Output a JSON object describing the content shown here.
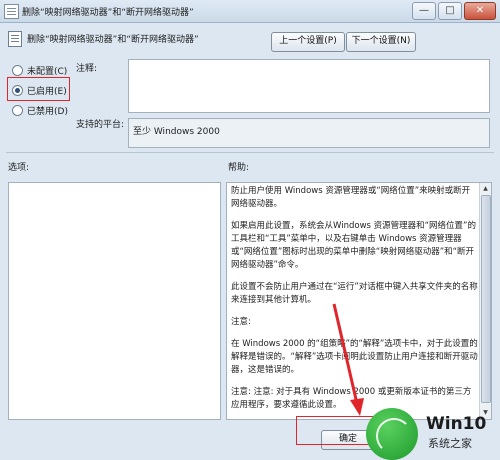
{
  "window": {
    "title": "删除“映射网络驱动器”和“断开网络驱动器”",
    "minimize": "—",
    "maximize": "□",
    "close": "✕"
  },
  "header": {
    "title": "删除“映射网络驱动器”和“断开网络驱动器”",
    "prev_button": "上一个设置(P)",
    "next_button": "下一个设置(N)"
  },
  "state": {
    "options": [
      {
        "label": "未配置(C)",
        "selected": false
      },
      {
        "label": "已启用(E)",
        "selected": true
      },
      {
        "label": "已禁用(D)",
        "selected": false
      }
    ]
  },
  "comment": {
    "label": "注释:",
    "value": ""
  },
  "platform": {
    "label": "支持的平台:",
    "value": "至少 Windows 2000"
  },
  "panels": {
    "options_label": "选项:",
    "help_label": "帮助:"
  },
  "help": {
    "paragraphs": [
      "防止用户使用 Windows 资源管理器或“网络位置”来映射或断开网络驱动器。",
      "如果启用此设置，系统会从Windows 资源管理器和“网络位置”的工具栏和“工具”菜单中，以及右键单击 Windows 资源管理器或“网络位置”图标时出现的菜单中删除“映射网络驱动器”和“断开网络驱动器”命令。",
      "此设置不会防止用户通过在“运行”对话框中键入共享文件夹的名称来连接到其他计算机。",
      "注意:",
      "在 Windows 2000 的“组策略”的“解释”选项卡中，对于此设置的解释是错误的。“解释”选项卡阐明此设置防止用户连接和断开驱动器，这是错误的。",
      "注意: 注意: 对于具有 Windows 2000 或更新版本证书的第三方应用程序，要求遵循此设置。"
    ]
  },
  "footer": {
    "ok_button": "确定"
  },
  "watermark": {
    "brand": "Win10",
    "site": "系统之家"
  },
  "colors": {
    "highlight_red": "#e0252b",
    "logo_green": "#1c9a2c"
  }
}
